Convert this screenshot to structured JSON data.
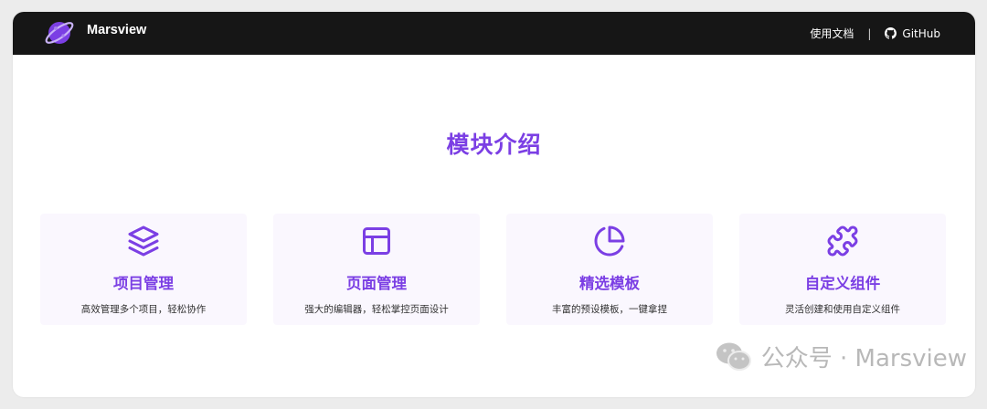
{
  "navbar": {
    "brand": "Marsview",
    "links": [
      {
        "label": "使用文档"
      },
      {
        "label": "GitHub"
      }
    ],
    "separator": "|"
  },
  "section": {
    "title": "模块介绍"
  },
  "cards": [
    {
      "title": "项目管理",
      "desc": "高效管理多个项目，轻松协作",
      "icon": "layers-icon"
    },
    {
      "title": "页面管理",
      "desc": "强大的编辑器，轻松掌控页面设计",
      "icon": "layout-icon"
    },
    {
      "title": "精选模板",
      "desc": "丰富的预设模板，一键拿捏",
      "icon": "pie-chart-icon"
    },
    {
      "title": "自定义组件",
      "desc": "灵活创建和使用自定义组件",
      "icon": "puzzle-icon"
    }
  ],
  "watermark": {
    "text": "公众号 · Marsview"
  },
  "colors": {
    "accent": "#7b3fe4",
    "navbar": "#161616",
    "card_bg": "#faf7fe"
  }
}
